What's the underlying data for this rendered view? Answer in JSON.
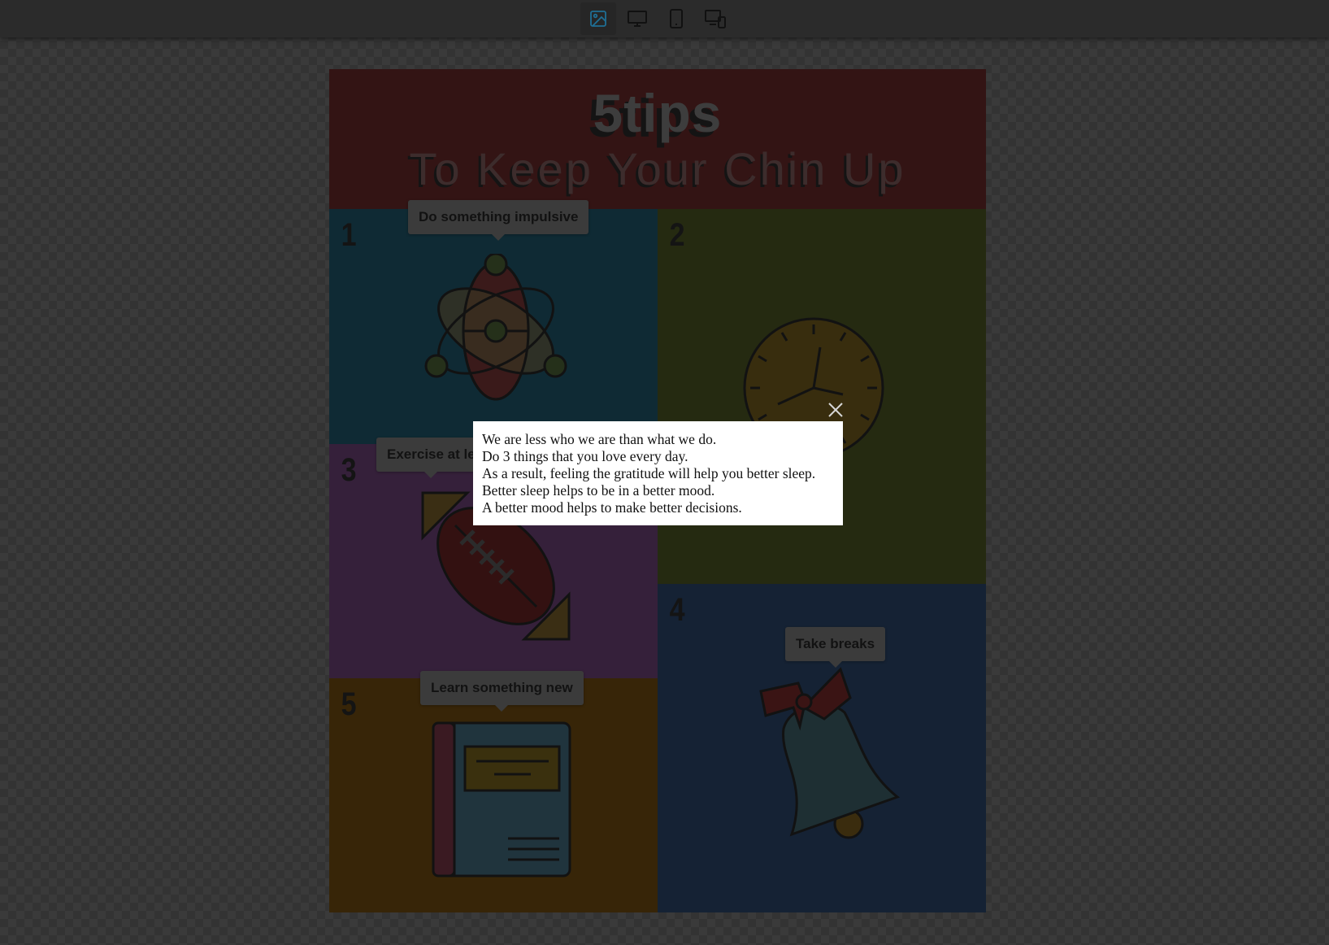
{
  "toolbar": {
    "buttons": [
      {
        "icon": "image-icon",
        "active": true
      },
      {
        "icon": "desktop-icon",
        "active": false
      },
      {
        "icon": "tablet-icon",
        "active": false
      },
      {
        "icon": "responsive-devices-icon",
        "active": false
      }
    ]
  },
  "poster": {
    "title": "5tips",
    "subtitle": "To Keep Your Chin Up",
    "tips": [
      {
        "number": "1",
        "label": "Do something impulsive",
        "icon": "atom-icon"
      },
      {
        "number": "2",
        "label": "",
        "icon": "clock-icon"
      },
      {
        "number": "3",
        "label": "Exercise at le",
        "icon": "football-icon"
      },
      {
        "number": "4",
        "label": "Take breaks",
        "icon": "bell-icon"
      },
      {
        "number": "5",
        "label": "Learn something new",
        "icon": "book-icon"
      }
    ]
  },
  "modal": {
    "lines": [
      "We are less who we are than what we do.",
      "Do 3 things that you love every day.",
      "As a result, feeling the gratitude will help you better sleep.",
      "Better sleep helps to be in a better mood.",
      "A better mood helps to make better decisions."
    ],
    "close_icon": "close-icon"
  }
}
